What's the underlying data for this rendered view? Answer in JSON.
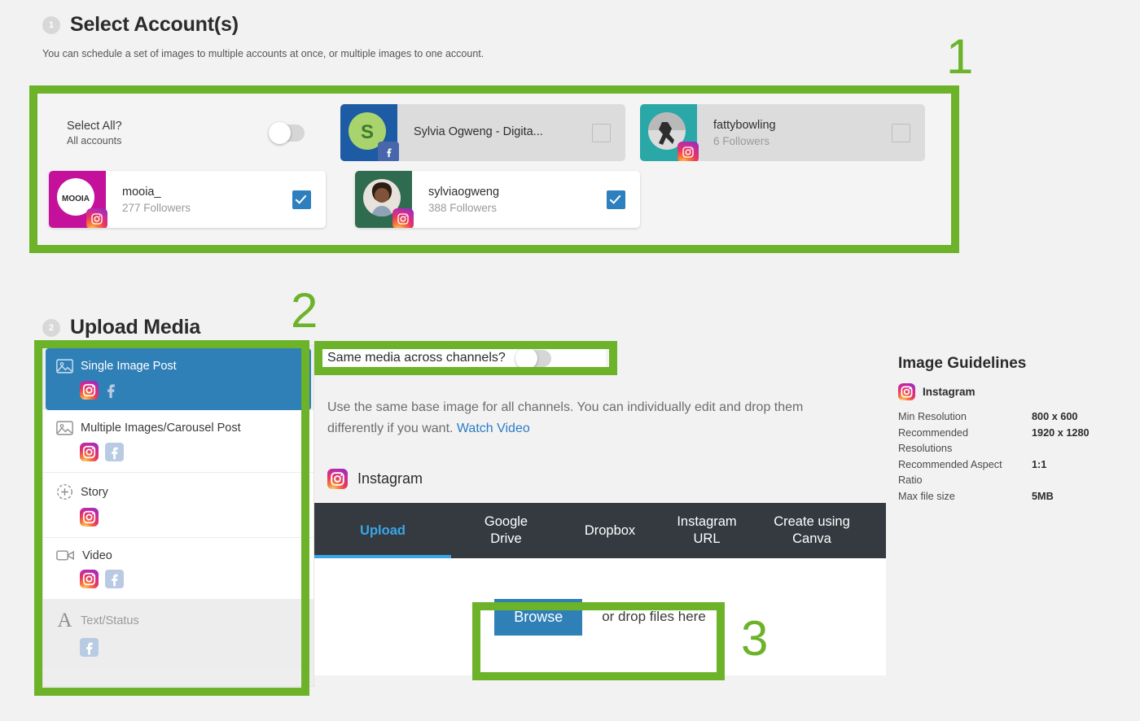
{
  "accounts_section": {
    "step_number": "1",
    "title": "Select Account(s)",
    "subtitle": "You can schedule a set of images to multiple accounts at once, or multiple images to one account.",
    "select_all": {
      "label": "Select All?",
      "sub_label": "All accounts",
      "toggle_state": "off"
    },
    "accounts": [
      {
        "name": "Sylvia Ogweng - Digita...",
        "followers": "",
        "network": "facebook",
        "selected": false,
        "avatar_bg": "#1d5ba4",
        "avatar_fg": "#a8d36d",
        "avatar_letter": "S"
      },
      {
        "name": "fattybowling",
        "followers": "6 Followers",
        "network": "instagram",
        "selected": false,
        "avatar_bg": "#2aa7a7",
        "avatar_fg": "#dedede",
        "avatar_letter": ""
      },
      {
        "name": "mooia_",
        "followers": "277 Followers",
        "network": "instagram",
        "selected": true,
        "avatar_bg": "#c4109b",
        "avatar_fg": "#ffffff",
        "avatar_letter": "MOOIA"
      },
      {
        "name": "sylviaogweng",
        "followers": "388 Followers",
        "network": "instagram",
        "selected": true,
        "avatar_bg": "#2f6b4f",
        "avatar_fg": "#c9b59a",
        "avatar_letter": ""
      }
    ]
  },
  "upload_section": {
    "step_number": "2",
    "title": "Upload Media",
    "media_types": [
      {
        "label": "Single Image Post",
        "icon": "image-icon",
        "networks": [
          "instagram",
          "facebook-muted"
        ],
        "state": "selected"
      },
      {
        "label": "Multiple Images/Carousel Post",
        "icon": "image-icon",
        "networks": [
          "instagram",
          "facebook-muted"
        ],
        "state": "normal"
      },
      {
        "label": "Story",
        "icon": "plus-circle-icon",
        "networks": [
          "instagram"
        ],
        "state": "normal"
      },
      {
        "label": "Video",
        "icon": "video-icon",
        "networks": [
          "instagram",
          "facebook-muted"
        ],
        "state": "normal"
      },
      {
        "label": "Text/Status",
        "icon": "text-a-icon",
        "networks": [
          "facebook-muted"
        ],
        "state": "disabled"
      }
    ],
    "same_media": {
      "label": "Same media across channels?",
      "toggle_state": "off"
    },
    "description": "Use the same base image for all channels. You can individually edit and drop them differently if you want.",
    "description_link": "Watch Video",
    "channel_header": "Instagram",
    "tabs": [
      {
        "label": "Upload",
        "active": true
      },
      {
        "label": "Google Drive",
        "active": false
      },
      {
        "label": "Dropbox",
        "active": false
      },
      {
        "label": "Instagram URL",
        "active": false
      },
      {
        "label": "Create using Canva",
        "active": false
      }
    ],
    "dropzone": {
      "browse_label": "Browse",
      "hint": "or drop files here"
    }
  },
  "guidelines": {
    "title": "Image Guidelines",
    "channel": "Instagram",
    "rows": [
      {
        "key": "Min Resolution",
        "value": "800 x 600"
      },
      {
        "key": "Recommended Resolutions",
        "value": "1920 x 1280"
      },
      {
        "key": "Recommended Aspect Ratio",
        "value": "1:1"
      },
      {
        "key": "Max file size",
        "value": "5MB"
      }
    ]
  },
  "annotations": {
    "color": "#6cb32a",
    "markers": [
      {
        "label": "1"
      },
      {
        "label": "2"
      },
      {
        "label": "3"
      }
    ]
  }
}
